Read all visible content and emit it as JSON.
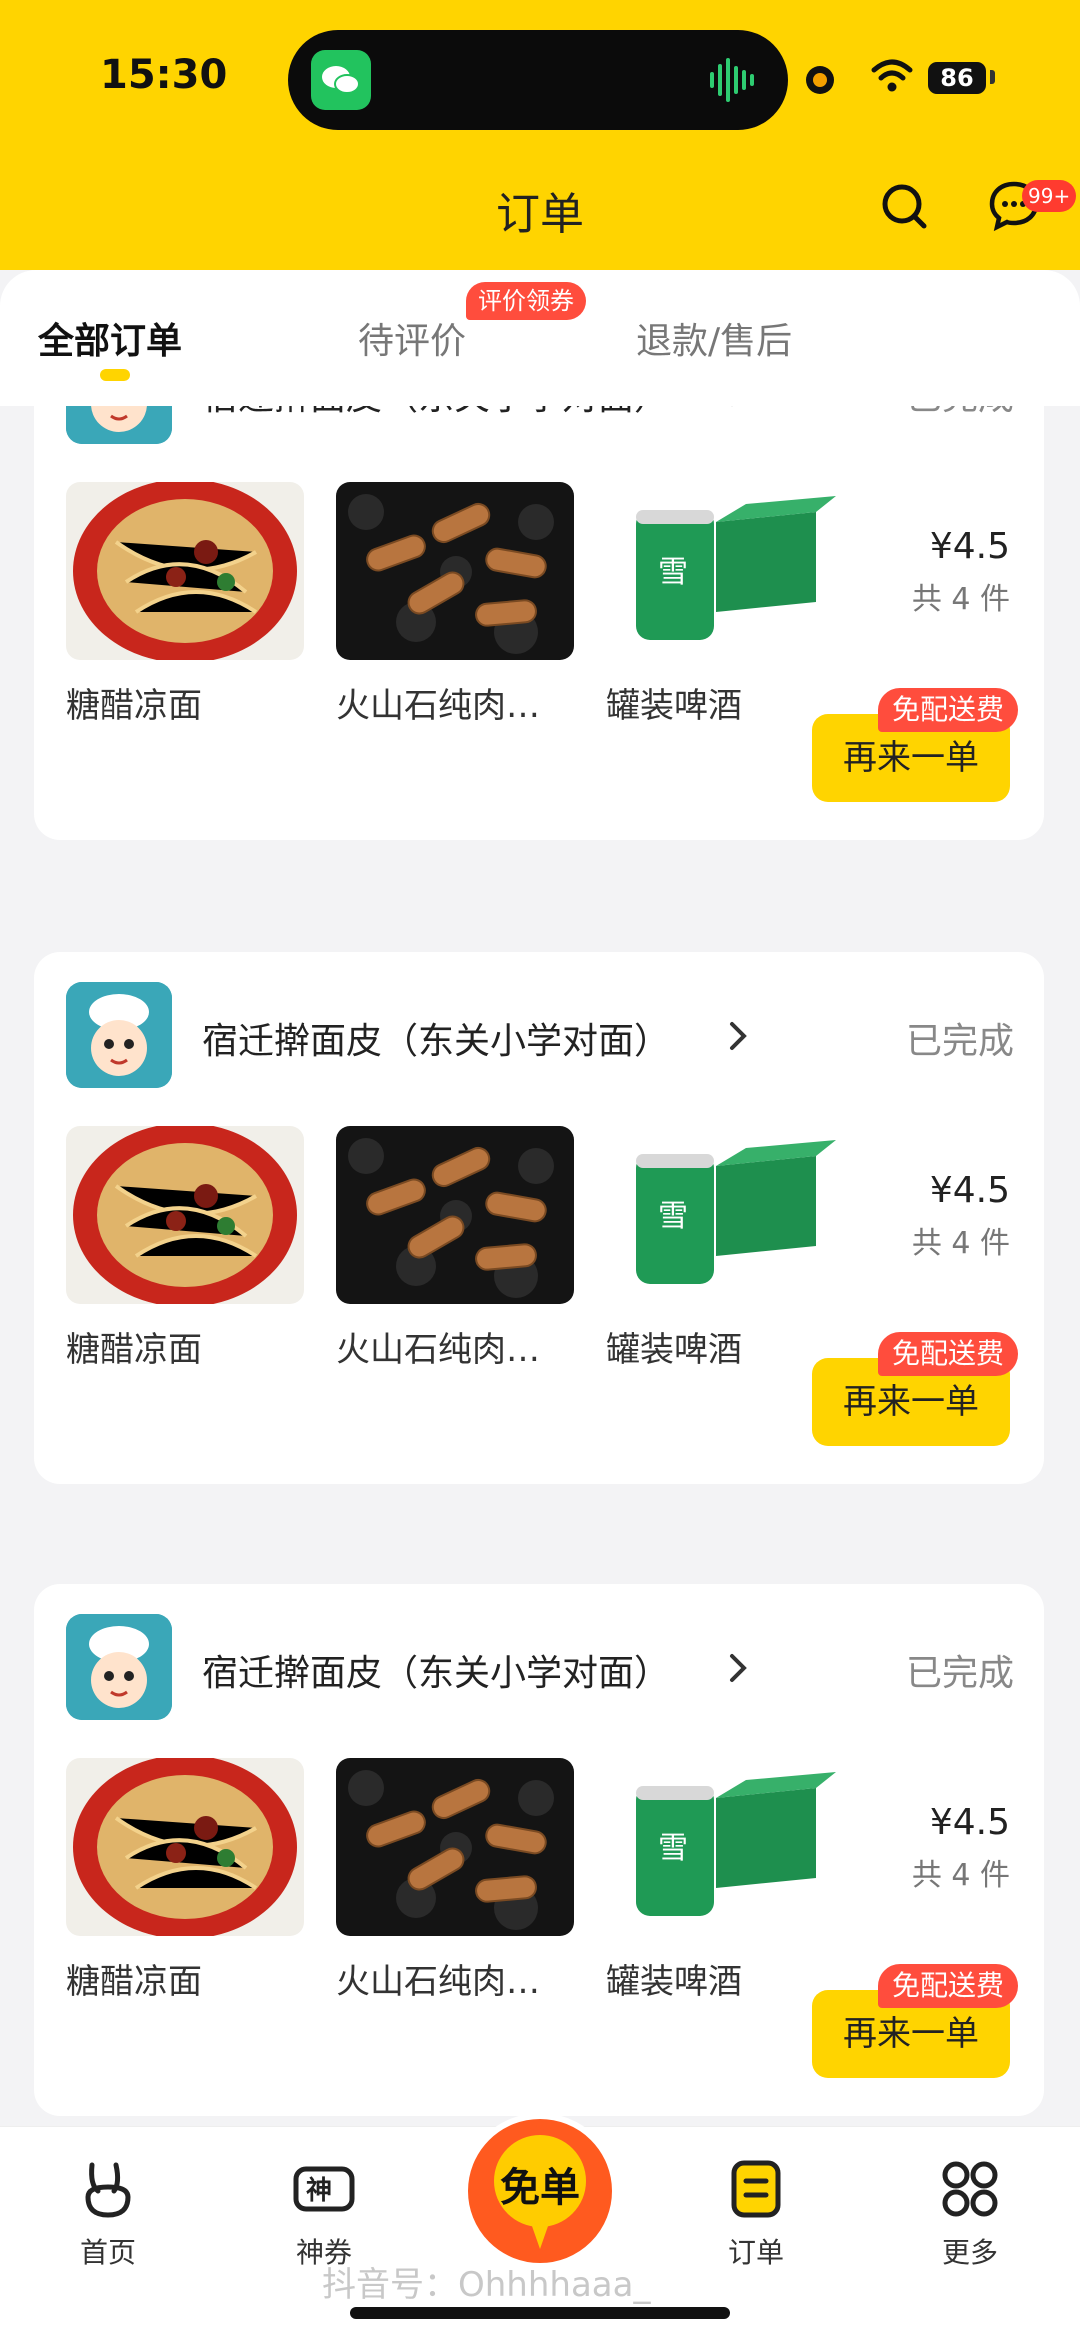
{
  "status_bar": {
    "time": "15:30",
    "battery": "86"
  },
  "header": {
    "title": "订单",
    "message_badge": "99+"
  },
  "tabs": [
    {
      "label": "全部订单"
    },
    {
      "label": "待评价",
      "badge": "评价领券"
    },
    {
      "label": "退款/售后"
    }
  ],
  "orders": [
    {
      "shop": "宿迁擀面皮（东关小学对面）",
      "status": "已完成",
      "items": [
        {
          "name": "糖醋凉面"
        },
        {
          "name": "火山石纯肉…"
        },
        {
          "name": "罐装啤酒"
        }
      ],
      "price": "¥4.5",
      "qty": "共 4 件",
      "button": "再来一单",
      "tag": "免配送费"
    },
    {
      "shop": "宿迁擀面皮（东关小学对面）",
      "status": "已完成",
      "items": [
        {
          "name": "糖醋凉面"
        },
        {
          "name": "火山石纯肉…"
        },
        {
          "name": "罐装啤酒"
        }
      ],
      "price": "¥4.5",
      "qty": "共 4 件",
      "button": "再来一单",
      "tag": "免配送费"
    },
    {
      "shop": "宿迁擀面皮（东关小学对面）",
      "status": "已完成",
      "items": [
        {
          "name": "糖醋凉面"
        },
        {
          "name": "火山石纯肉…"
        },
        {
          "name": "罐装啤酒"
        }
      ],
      "price": "¥4.5",
      "qty": "共 4 件",
      "button": "再来一单",
      "tag": "免配送费"
    }
  ],
  "bottom_nav": {
    "items": [
      {
        "label": "首页",
        "icon": "rabbit-home-icon"
      },
      {
        "label": "神券",
        "icon": "coupon-icon"
      },
      {
        "label": "订单",
        "icon": "order-list-icon"
      },
      {
        "label": "更多",
        "icon": "grid-more-icon"
      }
    ],
    "center_badge": "免单",
    "watermark": "抖音号：Ohhhhaaa_"
  },
  "colors": {
    "accent": "#ffd400",
    "badge": "#ff4d3d"
  }
}
